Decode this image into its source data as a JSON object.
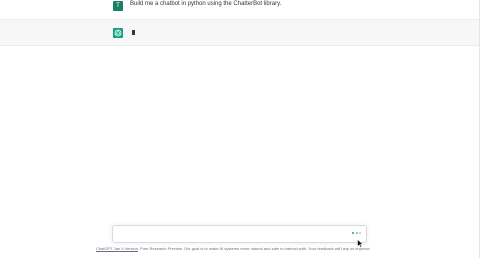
{
  "conversation": {
    "user_message": {
      "avatar_letter": "T",
      "text": "Build me a chatbot in python using the ChatterBot library."
    },
    "assistant_message": {
      "avatar_icon": "openai-logo-icon",
      "text": ""
    }
  },
  "composer": {
    "placeholder": "",
    "value": "",
    "status_icon": "loading-dots-icon"
  },
  "footer": {
    "link_text": "ChatGPT Jan 9 Version",
    "text": ". Free Research Preview. Our goal is to make AI systems more natural and safe to interact with. Your feedback will help us improve."
  },
  "colors": {
    "user_avatar": "#1a7f64",
    "assistant_avatar": "#10a37f",
    "assistant_row_bg": "#f7f7f8",
    "text": "#343541",
    "footer_text": "#6e6e80"
  }
}
